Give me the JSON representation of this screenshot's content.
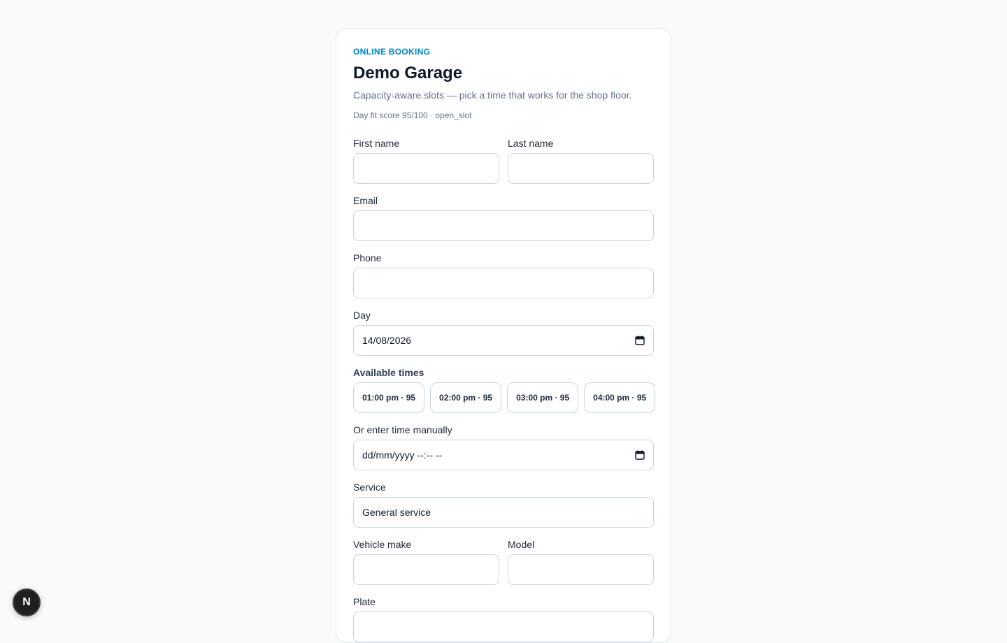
{
  "header": {
    "eyebrow": "ONLINE BOOKING",
    "title": "Demo Garage",
    "subtitle": "Capacity-aware slots — pick a time that works for the shop floor.",
    "fit_score": "Day fit score 95/100 · open_slot"
  },
  "form": {
    "first_name": {
      "label": "First name",
      "value": ""
    },
    "last_name": {
      "label": "Last name",
      "value": ""
    },
    "email": {
      "label": "Email",
      "value": ""
    },
    "phone": {
      "label": "Phone",
      "value": ""
    },
    "day": {
      "label": "Day",
      "value": "14/08/2026"
    },
    "available_times": {
      "label": "Available times",
      "slots": [
        "01:00 pm · 95",
        "02:00 pm · 95",
        "03:00 pm · 95",
        "04:00 pm · 95"
      ]
    },
    "manual_time": {
      "label": "Or enter time manually",
      "value": "dd/mm/yyyy --:-- --"
    },
    "service": {
      "label": "Service",
      "value": "General service"
    },
    "vehicle_make": {
      "label": "Vehicle make",
      "value": ""
    },
    "model": {
      "label": "Model",
      "value": ""
    },
    "plate": {
      "label": "Plate",
      "value": ""
    }
  },
  "dev_badge": {
    "letter": "N"
  },
  "colors": {
    "accent": "#0284c7",
    "background": "#f8fafc",
    "border": "#cbd5e1"
  }
}
